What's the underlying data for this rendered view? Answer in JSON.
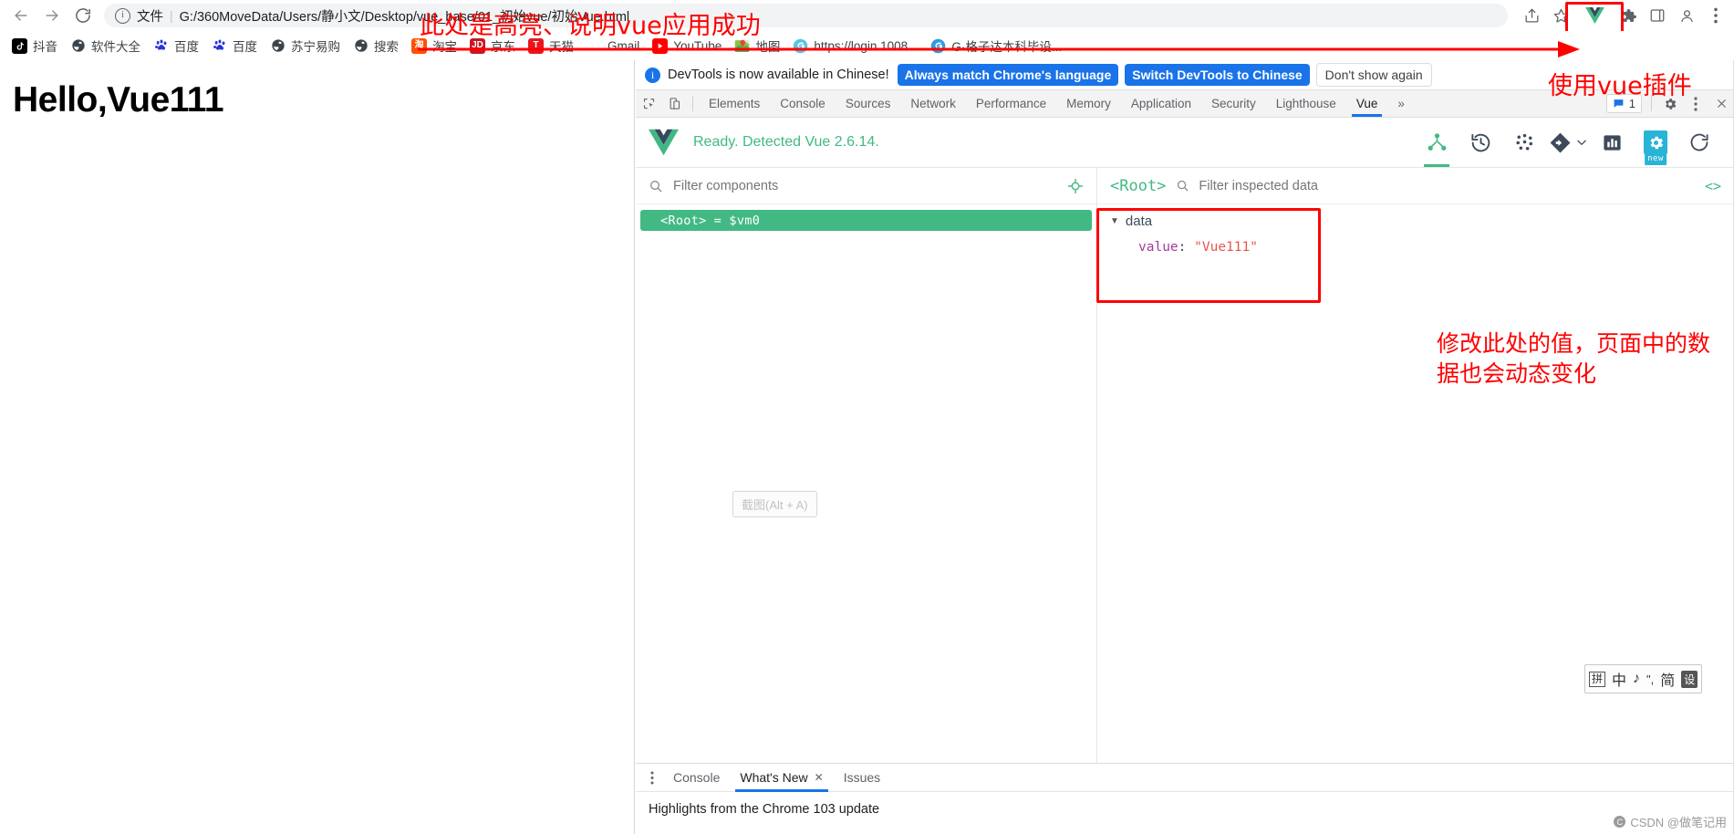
{
  "browser": {
    "nav": {
      "back_label": "Back",
      "forward_label": "Forward",
      "reload_label": "Reload"
    },
    "omnibox": {
      "scheme_label": "文件",
      "url": "G:/360MoveData/Users/静小文/Desktop/vue_base/01_初始vue/初始Vue.html",
      "info_icon": "info-icon"
    },
    "actions": [
      {
        "name": "share-icon",
        "glyph": "share"
      },
      {
        "name": "bookmark-star-icon",
        "glyph": "star"
      },
      {
        "name": "vue-extension-icon",
        "glyph": "vue"
      },
      {
        "name": "extensions-puzzle-icon",
        "glyph": "puzzle"
      },
      {
        "name": "sidepanel-icon",
        "glyph": "panel"
      },
      {
        "name": "profile-avatar-icon",
        "glyph": "person"
      },
      {
        "name": "chrome-menu-icon",
        "glyph": "kebab"
      }
    ]
  },
  "bookmarks": [
    {
      "label": "抖音",
      "icon": "douyin-icon"
    },
    {
      "label": "软件大全",
      "icon": "green-globe-icon"
    },
    {
      "label": "百度",
      "icon": "baidu-icon"
    },
    {
      "label": "百度",
      "icon": "baidu-icon"
    },
    {
      "label": "苏宁易购",
      "icon": "green-globe-icon"
    },
    {
      "label": "搜索",
      "icon": "green-globe-icon"
    },
    {
      "label": "淘宝",
      "icon": "taobao-icon"
    },
    {
      "label": "京东",
      "icon": "jd-icon"
    },
    {
      "label": "天猫",
      "icon": "tmall-icon"
    },
    {
      "label": "Gmail",
      "icon": "gmail-icon"
    },
    {
      "label": "YouTube",
      "icon": "youtube-icon"
    },
    {
      "label": "地图",
      "icon": "maps-icon"
    },
    {
      "label": "https://login.1008...",
      "icon": "swirl-icon"
    },
    {
      "label": "G·格子达本科毕设...",
      "icon": "swirl-icon"
    }
  ],
  "page": {
    "heading": "Hello,Vue111"
  },
  "devtools": {
    "infobar": {
      "message": "DevTools is now available in Chinese!",
      "primary_button": "Always match Chrome's language",
      "secondary_button": "Switch DevTools to Chinese",
      "dismiss_button": "Don't show again"
    },
    "tabs": [
      {
        "label": "Elements",
        "active": false
      },
      {
        "label": "Console",
        "active": false
      },
      {
        "label": "Sources",
        "active": false
      },
      {
        "label": "Network",
        "active": false
      },
      {
        "label": "Performance",
        "active": false
      },
      {
        "label": "Memory",
        "active": false
      },
      {
        "label": "Application",
        "active": false
      },
      {
        "label": "Security",
        "active": false
      },
      {
        "label": "Lighthouse",
        "active": false
      },
      {
        "label": "Vue",
        "active": true
      }
    ],
    "more_tabs_glyph": "»",
    "message_count": "1",
    "drawer": {
      "tabs": [
        {
          "label": "Console",
          "active": false,
          "closable": false
        },
        {
          "label": "What's New",
          "active": true,
          "closable": true
        },
        {
          "label": "Issues",
          "active": false,
          "closable": false
        }
      ],
      "content": "Highlights from the Chrome 103 update"
    }
  },
  "vue_devtools": {
    "status": "Ready. Detected Vue 2.6.14.",
    "toolbar": [
      {
        "name": "components-tree-icon",
        "active": true
      },
      {
        "name": "timeline-history-icon",
        "active": false
      },
      {
        "name": "vuex-icon",
        "active": false
      },
      {
        "name": "router-icon",
        "active": false
      },
      {
        "name": "performance-chart-icon",
        "active": false
      },
      {
        "name": "settings-gear-icon",
        "active": false,
        "badge": "new"
      },
      {
        "name": "refresh-icon",
        "active": false
      }
    ],
    "components_panel": {
      "filter_placeholder": "Filter components",
      "select_target_icon": "target-icon",
      "tree": [
        {
          "tag": "<Root>",
          "ref": "= $vm0",
          "selected": true
        }
      ],
      "screenshot_hint": "截图(Alt + A)"
    },
    "inspector": {
      "selected_component": "<Root>",
      "filter_placeholder": "Filter inspected data",
      "open_in_editor_icon": "code-brackets-icon",
      "groups": [
        {
          "name": "data",
          "expanded": true,
          "entries": [
            {
              "key": "value",
              "value": "\"Vue111\""
            }
          ]
        }
      ]
    }
  },
  "annotations": [
    {
      "id": "highlight-note",
      "text": "此处是高亮、说明vue应用成功"
    },
    {
      "id": "plugin-note",
      "text": "使用vue插件"
    },
    {
      "id": "data-note",
      "text": "修改此处的值，页面中的数据也会动态变化"
    }
  ],
  "ime": {
    "mode_label": "拼",
    "lang_label": "中",
    "tone_label": "♪",
    "punct_label": "\",",
    "shape_label": "简",
    "settings_label": "设"
  },
  "watermark": "CSDN @做笔记用",
  "colors": {
    "vue_green": "#42b983",
    "chrome_blue": "#1a73e8",
    "annotation_red": "#ff0000",
    "settings_cyan": "#27b4d6"
  }
}
